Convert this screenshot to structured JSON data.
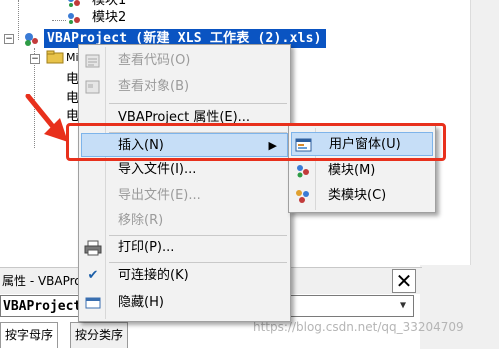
{
  "tree": {
    "items": [
      {
        "label": "模块1"
      },
      {
        "label": "模块2"
      },
      {
        "label": "VBAProject (新建 XLS 工作表 (2).xls)"
      }
    ],
    "truncated_labels": [
      "Mi",
      "电",
      "电",
      "电"
    ]
  },
  "context_menu": {
    "items": [
      {
        "label": "查看代码(O)",
        "enabled": false,
        "icon": "view-code-icon"
      },
      {
        "label": "查看对象(B)",
        "enabled": false,
        "icon": "view-object-icon"
      },
      {
        "label": "VBAProject 属性(E)...",
        "enabled": true
      },
      {
        "label": "插入(N)",
        "enabled": true,
        "highlighted": true,
        "submenu_arrow": "▶"
      },
      {
        "label": "导入文件(I)...",
        "enabled": true
      },
      {
        "label": "导出文件(E)...",
        "enabled": false
      },
      {
        "label": "移除(R)",
        "enabled": false
      },
      {
        "label": "打印(P)...",
        "enabled": true,
        "icon": "printer-icon"
      },
      {
        "label": "可连接的(K)",
        "enabled": true,
        "checked": true,
        "check": "✔"
      },
      {
        "label": "隐藏(H)",
        "enabled": true,
        "icon": "hide-window-icon"
      }
    ]
  },
  "submenu": {
    "items": [
      {
        "label": "用户窗体(U)",
        "highlighted": true,
        "icon": "userform-icon"
      },
      {
        "label": "模块(M)",
        "icon": "module-icon"
      },
      {
        "label": "类模块(C)",
        "icon": "class-module-icon"
      }
    ]
  },
  "properties": {
    "title": "属性 - VBAProj",
    "close_glyph": "✕",
    "combo_value": "VBAProject",
    "tabs": [
      {
        "label": "按字母序",
        "active": true
      },
      {
        "label": "按分类序",
        "active": false
      }
    ]
  },
  "watermark": "https://blog.csdn.net/qq_33204709",
  "colors": {
    "selection": "#0a54c2",
    "menu_highlight": "#c6def7",
    "annotation_red": "#e8301c"
  }
}
